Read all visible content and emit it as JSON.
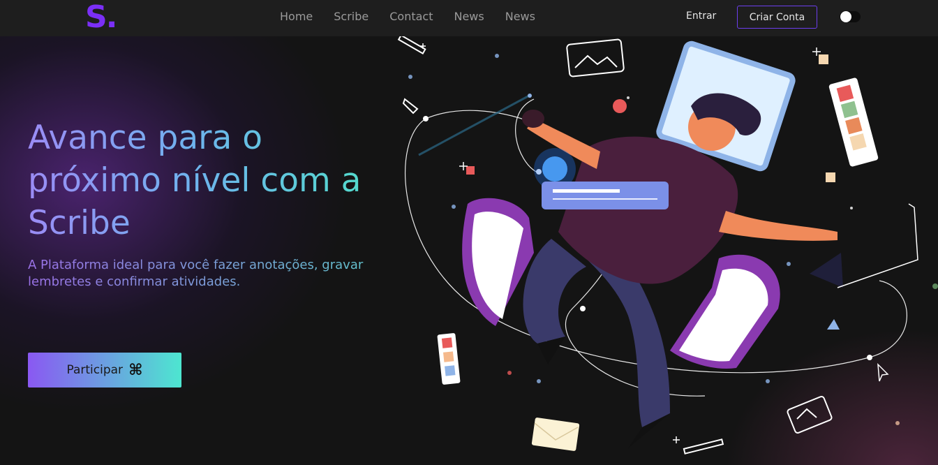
{
  "navbar": {
    "logo": "S.",
    "links": [
      "Home",
      "Scribe",
      "Contact",
      "News",
      "News"
    ],
    "login_label": "Entrar",
    "signup_label": "Criar Conta",
    "toggle_state": "off"
  },
  "hero": {
    "headline": "Avance para o próximo nível com a Scribe",
    "subtitle": "A Plataforma ideal para você fazer anotações, gravar lembretes e confirmar atividades.",
    "cta_label": "Participar",
    "cta_icon": "⌘"
  },
  "colors": {
    "brand": "#7b2ff7",
    "gradient_start": "#8a58f2",
    "gradient_end": "#4de6d0",
    "background": "#141414"
  }
}
